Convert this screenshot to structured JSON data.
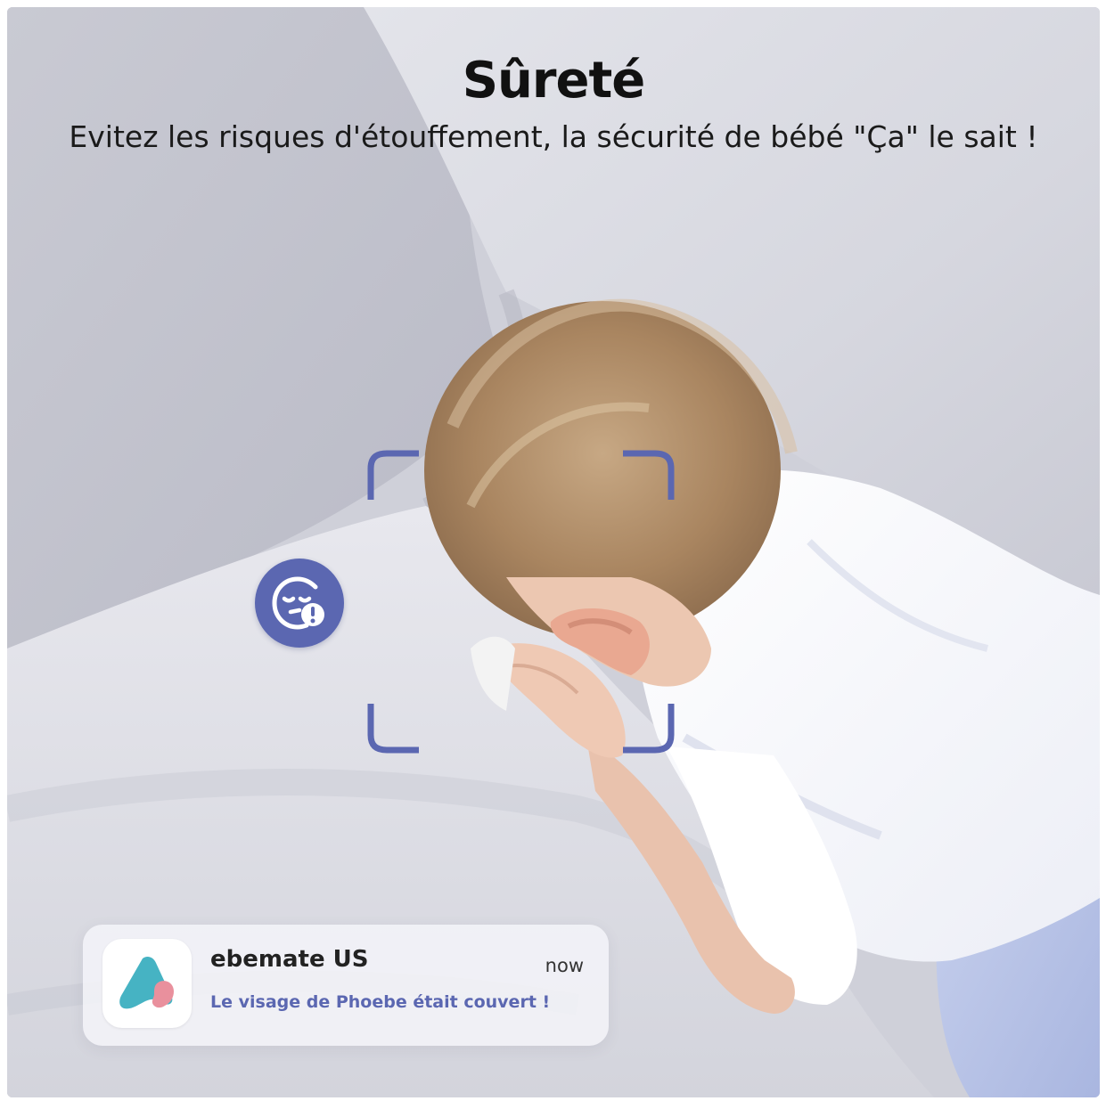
{
  "header": {
    "title": "Sûreté",
    "subtitle": "Evitez les risques d'étouffement, la sécurité de bébé \"Ça\" le sait !"
  },
  "scene": {
    "photo_subject": "baby-face-covered-photo",
    "accent_color": "#5b67b1"
  },
  "overlay": {
    "badge_icon": "face-covered-warning-icon",
    "frame_icon": "face-detection-frame"
  },
  "notification": {
    "app_icon": "ebemate-logo-icon",
    "app_name": "ebemate US",
    "time": "now",
    "message": "Le visage de Phoebe était couvert !"
  }
}
